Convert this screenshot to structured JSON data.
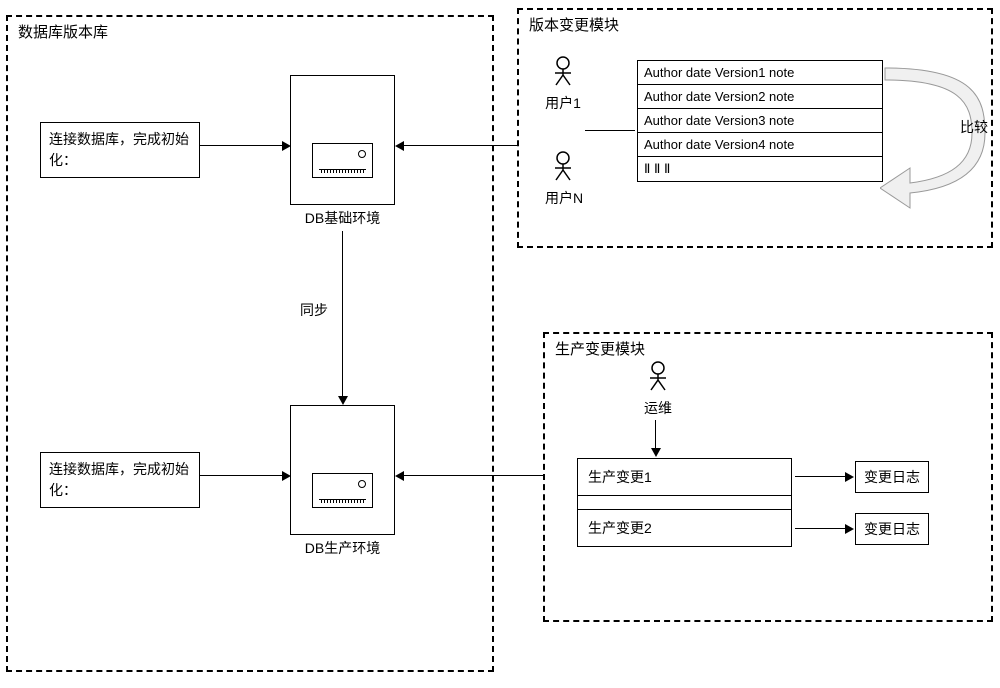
{
  "regions": {
    "db_repo_label": "数据库版本库",
    "version_change_label": "版本变更模块",
    "prod_change_label": "生产变更模块"
  },
  "init_box": "连接数据库，完成初始化：",
  "servers": {
    "base_label": "DB基础环境",
    "prod_label": "DB生产环境"
  },
  "sync_label": "同步",
  "users": {
    "user1": "用户1",
    "userN": "用户N",
    "ops": "运维"
  },
  "version_table": {
    "row1": "Author date Version1   note",
    "row2": "Author date Version2   note",
    "row3": "Author date Version3   note",
    "row4": "Author date Version4   note",
    "row5": "Ⅱ Ⅱ Ⅱ"
  },
  "compare_label": "比较",
  "prod_table": {
    "row1": "生产变更1",
    "row2": "生产变更2"
  },
  "log_label": "变更日志"
}
